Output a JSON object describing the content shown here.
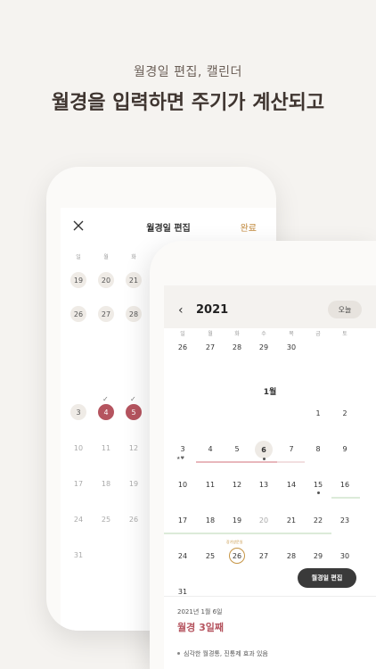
{
  "header": {
    "subtitle": "월경일 편집, 캘린더",
    "headline": "월경을 입력하면 주기가 계산되고"
  },
  "back_phone": {
    "title": "월경일 편집",
    "done_label": "완료",
    "weekdays": [
      "일",
      "월",
      "화"
    ],
    "rows": [
      [
        "19",
        "20",
        "21"
      ],
      [
        "26",
        "27",
        "28"
      ],
      [
        "3",
        "4",
        "5"
      ],
      [
        "10",
        "11",
        "12"
      ],
      [
        "17",
        "18",
        "19"
      ],
      [
        "24",
        "25",
        "26"
      ],
      [
        "31"
      ]
    ],
    "selected_days": [
      "4",
      "5"
    ],
    "checked_days": [
      "4",
      "5"
    ],
    "accent_color": "#b5545f"
  },
  "front_phone": {
    "year": "2021",
    "today_label": "오늘",
    "weekdays": [
      "일",
      "월",
      "화",
      "수",
      "목",
      "금",
      "토"
    ],
    "prev_month_days": [
      "26",
      "27",
      "28",
      "29",
      "30"
    ],
    "month_label": "1월",
    "weeks": [
      [
        "",
        "",
        "",
        "",
        "",
        "1",
        "2"
      ],
      [
        "3",
        "4",
        "5",
        "6",
        "7",
        "8",
        "9"
      ],
      [
        "10",
        "11",
        "12",
        "13",
        "14",
        "15",
        "16"
      ],
      [
        "17",
        "18",
        "19",
        "20",
        "21",
        "22",
        "23"
      ],
      [
        "24",
        "25",
        "26",
        "27",
        "28",
        "29",
        "30"
      ],
      [
        "31"
      ]
    ],
    "marker_on_3": "★♥",
    "ring_day_caption": "장기방문일",
    "edit_button": "월경일 편집",
    "sheet": {
      "date": "2021년 1월 6일",
      "phase": "월경 3일째",
      "note": "심각한 월경통, 진통제 효과 있음"
    }
  }
}
